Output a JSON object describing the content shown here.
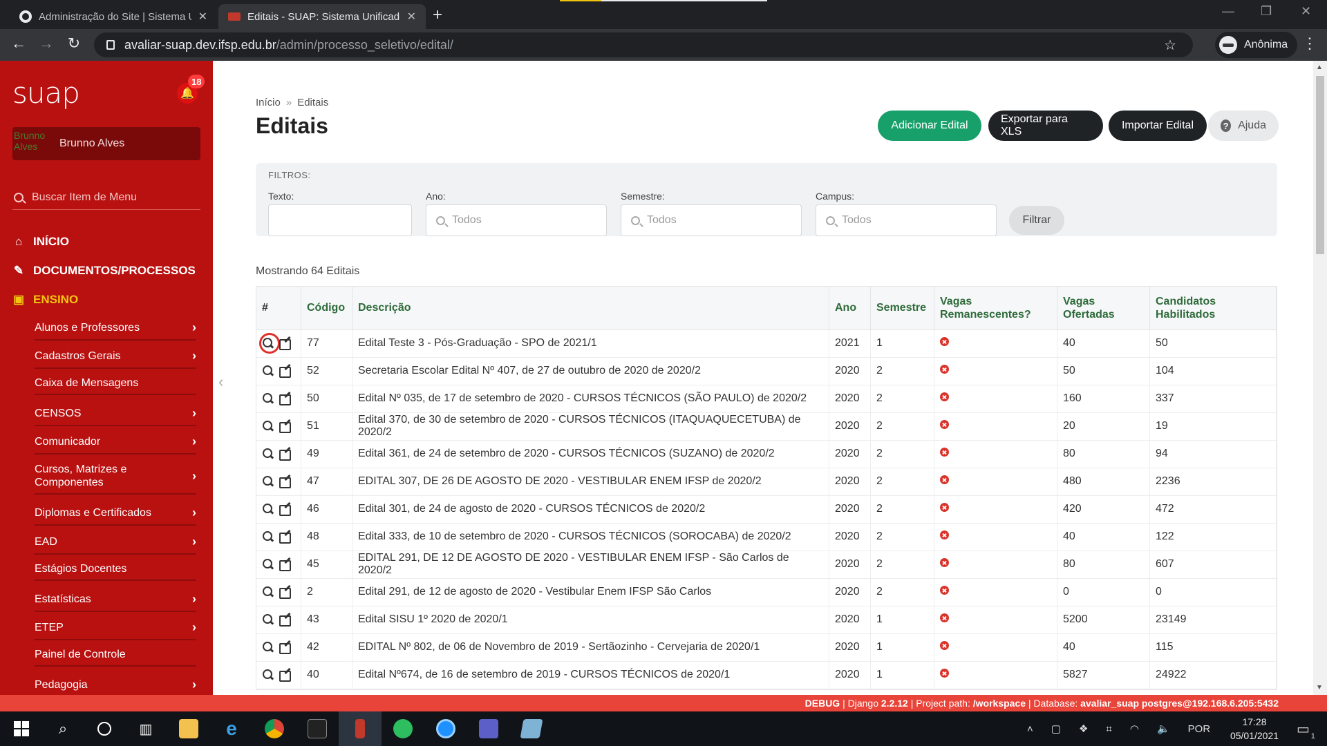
{
  "browser": {
    "tabs": [
      {
        "title": "Administração do Site | Sistema Unificado"
      },
      {
        "title": "Editais - SUAP: Sistema Unificado de Administração Pública"
      }
    ],
    "url_host": "avaliar-suap.dev.ifsp.edu.br",
    "url_path": "/admin/processo_seletivo/edital/",
    "profile_label": "Anônima"
  },
  "sidebar": {
    "logo": "suap",
    "notification_count": "18",
    "user_name": "Brunno Alves",
    "avatar_alt": "Brunno Alves",
    "search_placeholder": "Buscar Item de Menu",
    "top_items": [
      {
        "label": "INÍCIO",
        "icon": "home-icon"
      },
      {
        "label": "DOCUMENTOS/PROCESSOS",
        "icon": "document-icon"
      },
      {
        "label": "ENSINO",
        "icon": "teaching-icon"
      }
    ],
    "sub_items": [
      {
        "label": "Alunos e Professores",
        "chevron": "›"
      },
      {
        "label": "Cadastros Gerais",
        "chevron": "›"
      },
      {
        "label": "Caixa de Mensagens",
        "chevron": ""
      },
      {
        "label": "CENSOS",
        "chevron": "›"
      },
      {
        "label": "Comunicador",
        "chevron": "›"
      },
      {
        "label": "Cursos, Matrizes e Componentes",
        "chevron": "›"
      },
      {
        "label": "Diplomas e Certificados",
        "chevron": "›"
      },
      {
        "label": "EAD",
        "chevron": "›"
      },
      {
        "label": "Estágios Docentes",
        "chevron": ""
      },
      {
        "label": "Estatísticas",
        "chevron": "›"
      },
      {
        "label": "ETEP",
        "chevron": "›"
      },
      {
        "label": "Painel de Controle",
        "chevron": ""
      },
      {
        "label": "Pedagogia",
        "chevron": "›"
      }
    ]
  },
  "main": {
    "breadcrumb": {
      "home": "Início",
      "sep": "»",
      "current": "Editais"
    },
    "title": "Editais",
    "buttons": {
      "add": "Adicionar Edital",
      "export": "Exportar para XLS",
      "import": "Importar Edital",
      "help": "Ajuda"
    },
    "filters": {
      "heading": "FILTROS:",
      "texto_label": "Texto:",
      "ano_label": "Ano:",
      "ano_value": "Todos",
      "semestre_label": "Semestre:",
      "semestre_value": "Todos",
      "campus_label": "Campus:",
      "campus_value": "Todos",
      "submit": "Filtrar"
    },
    "count_text": "Mostrando 64 Editais",
    "table": {
      "headers": {
        "hash": "#",
        "codigo": "Código",
        "descricao": "Descrição",
        "ano": "Ano",
        "semestre": "Semestre",
        "vagas_rem": "Vagas Remanescentes?",
        "vagas_of": "Vagas Ofertadas",
        "candidatos": "Candidatos Habilitados"
      },
      "rows": [
        {
          "codigo": "77",
          "descricao": "Edital Teste 3 - Pós-Graduação - SPO de 2021/1",
          "ano": "2021",
          "semestre": "1",
          "vagas_of": "40",
          "candidatos": "50"
        },
        {
          "codigo": "52",
          "descricao": "Secretaria Escolar Edital Nº 407, de 27 de outubro de 2020 de 2020/2",
          "ano": "2020",
          "semestre": "2",
          "vagas_of": "50",
          "candidatos": "104"
        },
        {
          "codigo": "50",
          "descricao": "Edital Nº 035, de 17 de setembro de 2020 - CURSOS TÉCNICOS (SÃO PAULO) de 2020/2",
          "ano": "2020",
          "semestre": "2",
          "vagas_of": "160",
          "candidatos": "337"
        },
        {
          "codigo": "51",
          "descricao": "Edital 370, de 30 de setembro de 2020 - CURSOS TÉCNICOS (ITAQUAQUECETUBA) de 2020/2",
          "ano": "2020",
          "semestre": "2",
          "vagas_of": "20",
          "candidatos": "19"
        },
        {
          "codigo": "49",
          "descricao": "Edital 361, de 24 de setembro de 2020 - CURSOS TÉCNICOS (SUZANO) de 2020/2",
          "ano": "2020",
          "semestre": "2",
          "vagas_of": "80",
          "candidatos": "94"
        },
        {
          "codigo": "47",
          "descricao": "EDITAL 307, DE 26 DE AGOSTO DE 2020 - VESTIBULAR ENEM IFSP de 2020/2",
          "ano": "2020",
          "semestre": "2",
          "vagas_of": "480",
          "candidatos": "2236"
        },
        {
          "codigo": "46",
          "descricao": "Edital 301, de 24 de agosto de 2020 - CURSOS TÉCNICOS de 2020/2",
          "ano": "2020",
          "semestre": "2",
          "vagas_of": "420",
          "candidatos": "472"
        },
        {
          "codigo": "48",
          "descricao": "Edital 333, de 10 de setembro de 2020 - CURSOS TÉCNICOS (SOROCABA) de 2020/2",
          "ano": "2020",
          "semestre": "2",
          "vagas_of": "40",
          "candidatos": "122"
        },
        {
          "codigo": "45",
          "descricao": "EDITAL 291, DE 12 DE AGOSTO DE 2020 - VESTIBULAR ENEM IFSP - São Carlos de 2020/2",
          "ano": "2020",
          "semestre": "2",
          "vagas_of": "80",
          "candidatos": "607"
        },
        {
          "codigo": "2",
          "descricao": "Edital 291, de 12 de agosto de 2020 - Vestibular Enem IFSP São Carlos",
          "ano": "2020",
          "semestre": "2",
          "vagas_of": "0",
          "candidatos": "0"
        },
        {
          "codigo": "43",
          "descricao": "Edital SISU 1º 2020 de 2020/1",
          "ano": "2020",
          "semestre": "1",
          "vagas_of": "5200",
          "candidatos": "23149"
        },
        {
          "codigo": "42",
          "descricao": "EDITAL Nº 802, de 06 de Novembro de 2019 - Sertãozinho - Cervejaria de 2020/1",
          "ano": "2020",
          "semestre": "1",
          "vagas_of": "40",
          "candidatos": "115"
        },
        {
          "codigo": "40",
          "descricao": "Edital Nº674, de 16 de setembro de 2019 - CURSOS TÉCNICOS de 2020/1",
          "ano": "2020",
          "semestre": "1",
          "vagas_of": "5827",
          "candidatos": "24922"
        }
      ]
    }
  },
  "debug_bar": {
    "debug": "DEBUG",
    "django_label": "Django",
    "django_version": "2.2.12",
    "project_label": "Project path:",
    "project_path": "/workspace",
    "db_label": "Database:",
    "db_value": "avaliar_suap postgres@192.168.6.205:5432"
  },
  "taskbar": {
    "lang": "POR",
    "time": "17:28",
    "date": "05/01/2021",
    "notif_count": "1"
  },
  "colors": {
    "sidebar": "#b91010",
    "accent_green": "#18a06a",
    "header_green": "#2e6b3a",
    "debug_red": "#e8443a"
  }
}
